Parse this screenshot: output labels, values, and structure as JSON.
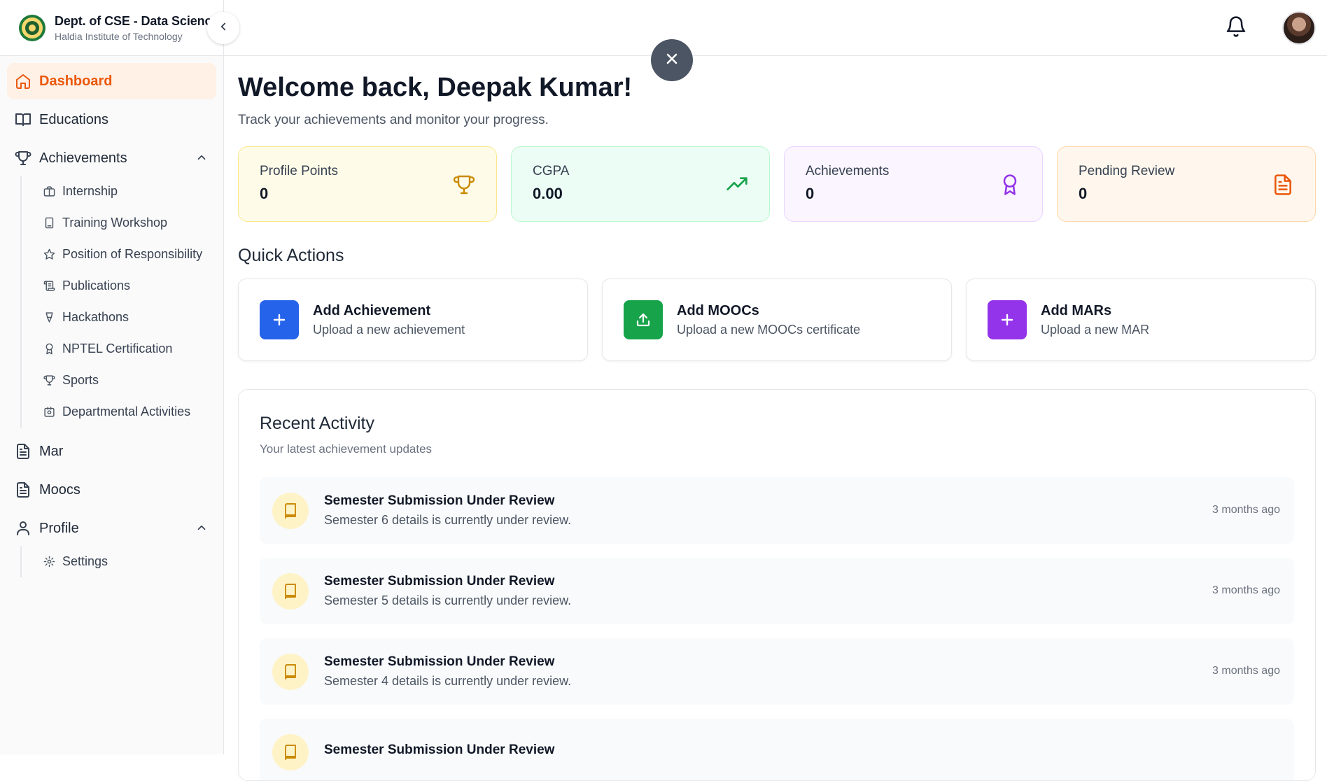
{
  "brand": {
    "title": "Dept. of CSE - Data Science",
    "subtitle": "Haldia Institute of Technology"
  },
  "sidebar": {
    "items": [
      {
        "label": "Dashboard",
        "icon": "home-icon",
        "active": true
      },
      {
        "label": "Educations",
        "icon": "book-open-icon"
      },
      {
        "label": "Achievements",
        "icon": "trophy-icon",
        "expanded": true,
        "children": [
          {
            "label": "Internship",
            "icon": "briefcase-icon"
          },
          {
            "label": "Training Workshop",
            "icon": "tablet-icon"
          },
          {
            "label": "Position of Responsibility",
            "icon": "star-icon"
          },
          {
            "label": "Publications",
            "icon": "scroll-icon"
          },
          {
            "label": "Hackathons",
            "icon": "trophy-icon"
          },
          {
            "label": "NPTEL Certification",
            "icon": "award-icon"
          },
          {
            "label": "Sports",
            "icon": "trophy-icon"
          },
          {
            "label": "Departmental Activities",
            "icon": "building-icon"
          }
        ]
      },
      {
        "label": "Mar",
        "icon": "file-text-icon"
      },
      {
        "label": "Moocs",
        "icon": "file-text-icon"
      },
      {
        "label": "Profile",
        "icon": "user-icon",
        "expanded": true,
        "children": [
          {
            "label": "Settings",
            "icon": "gear-icon"
          }
        ]
      }
    ]
  },
  "main": {
    "welcome": "Welcome back, Deepak Kumar!",
    "subtitle": "Track your achievements and monitor your progress.",
    "stats": [
      {
        "label": "Profile Points",
        "value": "0",
        "icon": "trophy-icon",
        "color": "#ca8a04"
      },
      {
        "label": "CGPA",
        "value": "0.00",
        "icon": "trending-up-icon",
        "color": "#16a34a"
      },
      {
        "label": "Achievements",
        "value": "0",
        "icon": "award-icon",
        "color": "#9333ea"
      },
      {
        "label": "Pending Review",
        "value": "0",
        "icon": "file-text-icon",
        "color": "#ea580c"
      }
    ],
    "quick_actions_title": "Quick Actions",
    "quick_actions": [
      {
        "title": "Add Achievement",
        "subtitle": "Upload a new achievement",
        "icon": "plus-icon",
        "color": "#2563eb"
      },
      {
        "title": "Add MOOCs",
        "subtitle": "Upload a new MOOCs certificate",
        "icon": "upload-icon",
        "color": "#16a34a"
      },
      {
        "title": "Add MARs",
        "subtitle": "Upload a new MAR",
        "icon": "plus-icon",
        "color": "#9333ea"
      }
    ],
    "recent": {
      "title": "Recent Activity",
      "subtitle": "Your latest achievement updates",
      "items": [
        {
          "title": "Semester Submission Under Review",
          "detail": "Semester 6 details is currently under review.",
          "time": "3 months ago"
        },
        {
          "title": "Semester Submission Under Review",
          "detail": "Semester 5 details is currently under review.",
          "time": "3 months ago"
        },
        {
          "title": "Semester Submission Under Review",
          "detail": "Semester 4 details is currently under review.",
          "time": "3 months ago"
        },
        {
          "title": "Semester Submission Under Review",
          "detail": "",
          "time": ""
        }
      ]
    }
  }
}
